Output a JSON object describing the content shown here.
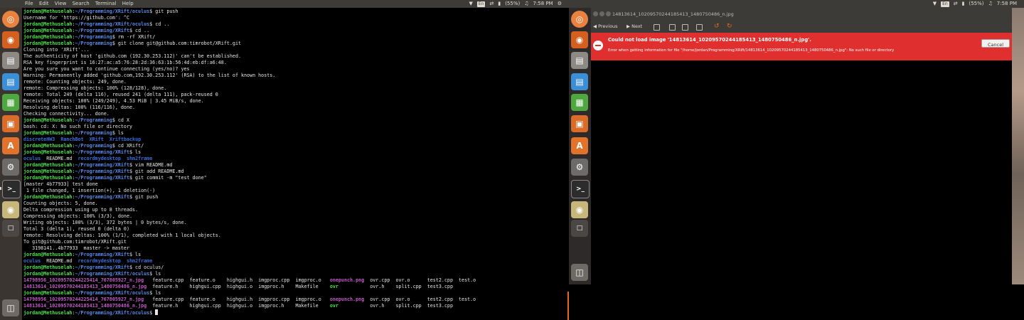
{
  "top_panel": {
    "menus": [
      "File",
      "Edit",
      "View",
      "Search",
      "Terminal",
      "Help"
    ],
    "keyboard": "En",
    "battery": "(55%)",
    "time": "7:58 PM"
  },
  "terminal": {
    "lines": [
      [
        [
          "u",
          "jordan@Methuselah"
        ],
        [
          "plain",
          ":"
        ],
        [
          "p",
          "~/Programming/XRift/oculus"
        ],
        [
          "plain",
          "$ git push"
        ]
      ],
      [
        [
          "plain",
          "Username for 'https://github.com': ^C"
        ]
      ],
      [
        [
          "u",
          "jordan@Methuselah"
        ],
        [
          "plain",
          ":"
        ],
        [
          "p",
          "~/Programming/XRift/oculus"
        ],
        [
          "plain",
          "$ cd .."
        ]
      ],
      [
        [
          "u",
          "jordan@Methuselah"
        ],
        [
          "plain",
          ":"
        ],
        [
          "p",
          "~/Programming/XRift"
        ],
        [
          "plain",
          "$ cd .."
        ]
      ],
      [
        [
          "u",
          "jordan@Methuselah"
        ],
        [
          "plain",
          ":"
        ],
        [
          "p",
          "~/Programming"
        ],
        [
          "plain",
          "$ rm -rf XRift/"
        ]
      ],
      [
        [
          "u",
          "jordan@Methuselah"
        ],
        [
          "plain",
          ":"
        ],
        [
          "p",
          "~/Programming"
        ],
        [
          "plain",
          "$ git clone git@github.com:timrobot/XRift.git"
        ]
      ],
      [
        [
          "plain",
          "Cloning into 'XRift'..."
        ]
      ],
      [
        [
          "plain",
          "The authenticity of host 'github.com (192.30.253.112)' can't be established."
        ]
      ],
      [
        [
          "plain",
          "RSA key fingerprint is 16:27:ac:a5:76:28:2d:36:63:1b:56:4d:eb:df:a6:48."
        ]
      ],
      [
        [
          "plain",
          "Are you sure you want to continue connecting (yes/no)? yes"
        ]
      ],
      [
        [
          "plain",
          "Warning: Permanently added 'github.com,192.30.253.112' (RSA) to the list of known hosts."
        ]
      ],
      [
        [
          "plain",
          "remote: Counting objects: 249, done."
        ]
      ],
      [
        [
          "plain",
          "remote: Compressing objects: 100% (128/128), done."
        ]
      ],
      [
        [
          "plain",
          "remote: Total 249 (delta 116), reused 241 (delta 111), pack-reused 0"
        ]
      ],
      [
        [
          "plain",
          "Receiving objects: 100% (249/249), 4.53 MiB | 3.45 MiB/s, done."
        ]
      ],
      [
        [
          "plain",
          "Resolving deltas: 100% (116/116), done."
        ]
      ],
      [
        [
          "plain",
          "Checking connectivity... done."
        ]
      ],
      [
        [
          "u",
          "jordan@Methuselah"
        ],
        [
          "plain",
          ":"
        ],
        [
          "p",
          "~/Programming"
        ],
        [
          "plain",
          "$ cd X"
        ]
      ],
      [
        [
          "plain",
          "bash: cd: X: No such file or directory"
        ]
      ],
      [
        [
          "u",
          "jordan@Methuselah"
        ],
        [
          "plain",
          ":"
        ],
        [
          "p",
          "~/Programming"
        ],
        [
          "plain",
          "$ ls"
        ]
      ],
      [
        [
          "dir",
          "discreteHW3"
        ],
        [
          "plain",
          "  "
        ],
        [
          "dir",
          "RanchBot"
        ],
        [
          "plain",
          "  "
        ],
        [
          "dir",
          "XRift"
        ],
        [
          "plain",
          "  "
        ],
        [
          "dir",
          "Xriftbackup"
        ]
      ],
      [
        [
          "u",
          "jordan@Methuselah"
        ],
        [
          "plain",
          ":"
        ],
        [
          "p",
          "~/Programming"
        ],
        [
          "plain",
          "$ cd XRift/"
        ]
      ],
      [
        [
          "u",
          "jordan@Methuselah"
        ],
        [
          "plain",
          ":"
        ],
        [
          "p",
          "~/Programming/XRift"
        ],
        [
          "plain",
          "$ ls"
        ]
      ],
      [
        [
          "dir",
          "oculus"
        ],
        [
          "plain",
          "  README.md  "
        ],
        [
          "dir",
          "recordmydesktop"
        ],
        [
          "plain",
          "  "
        ],
        [
          "dir",
          "shm2frame"
        ]
      ],
      [
        [
          "u",
          "jordan@Methuselah"
        ],
        [
          "plain",
          ":"
        ],
        [
          "p",
          "~/Programming/XRift"
        ],
        [
          "plain",
          "$ vim README.md"
        ]
      ],
      [
        [
          "u",
          "jordan@Methuselah"
        ],
        [
          "plain",
          ":"
        ],
        [
          "p",
          "~/Programming/XRift"
        ],
        [
          "plain",
          "$ git add README.md"
        ]
      ],
      [
        [
          "u",
          "jordan@Methuselah"
        ],
        [
          "plain",
          ":"
        ],
        [
          "p",
          "~/Programming/XRift"
        ],
        [
          "plain",
          "$ git commit -m \"test done\""
        ]
      ],
      [
        [
          "plain",
          "[master 4b77933] test done"
        ]
      ],
      [
        [
          "plain",
          " 1 file changed, 1 insertion(+), 1 deletion(-)"
        ]
      ],
      [
        [
          "u",
          "jordan@Methuselah"
        ],
        [
          "plain",
          ":"
        ],
        [
          "p",
          "~/Programming/XRift"
        ],
        [
          "plain",
          "$ git push"
        ]
      ],
      [
        [
          "plain",
          "Counting objects: 5, done."
        ]
      ],
      [
        [
          "plain",
          "Delta compression using up to 8 threads."
        ]
      ],
      [
        [
          "plain",
          "Compressing objects: 100% (3/3), done."
        ]
      ],
      [
        [
          "plain",
          "Writing objects: 100% (3/3), 372 bytes | 0 bytes/s, done."
        ]
      ],
      [
        [
          "plain",
          "Total 3 (delta 1), reused 0 (delta 0)"
        ]
      ],
      [
        [
          "plain",
          "remote: Resolving deltas: 100% (1/1), completed with 1 local objects."
        ]
      ],
      [
        [
          "plain",
          "To git@github.com:timrobot/XRift.git"
        ]
      ],
      [
        [
          "plain",
          "   3198141..4b77933  master -> master"
        ]
      ],
      [
        [
          "u",
          "jordan@Methuselah"
        ],
        [
          "plain",
          ":"
        ],
        [
          "p",
          "~/Programming/XRift"
        ],
        [
          "plain",
          "$ ls"
        ]
      ],
      [
        [
          "dir",
          "oculus"
        ],
        [
          "plain",
          "  README.md  "
        ],
        [
          "dir",
          "recordmydesktop"
        ],
        [
          "plain",
          "  "
        ],
        [
          "dir",
          "shm2frame"
        ]
      ],
      [
        [
          "u",
          "jordan@Methuselah"
        ],
        [
          "plain",
          ":"
        ],
        [
          "p",
          "~/Programming/XRift"
        ],
        [
          "plain",
          "$ cd oculus/"
        ]
      ],
      [
        [
          "u",
          "jordan@Methuselah"
        ],
        [
          "plain",
          ":"
        ],
        [
          "p",
          "~/Programming/XRift/oculus"
        ],
        [
          "plain",
          "$ ls"
        ]
      ],
      [
        [
          "img",
          "14798956_10209570244225414_767805927_n.jpg"
        ],
        [
          "plain",
          "   feature.cpp  feature.o    highgui.h  imgproc.cpp  imgproc.o   "
        ],
        [
          "img",
          "onepunch.png"
        ],
        [
          "plain",
          "  ovr.cpp  ovr.o      test2.cpp  test.o"
        ]
      ],
      [
        [
          "img",
          "14813614_10209570244185413_1480750486_n.jpg"
        ],
        [
          "plain",
          "  feature.h    highgui.cpp  highgui.o  imgproc.h    Makefile    "
        ],
        [
          "ex",
          "ovr"
        ],
        [
          "plain",
          "           ovr.h    split.cpp  test3.cpp"
        ]
      ],
      [
        [
          "u",
          "jordan@Methuselah"
        ],
        [
          "plain",
          ":"
        ],
        [
          "p",
          "~/Programming/XRift/oculus"
        ],
        [
          "plain",
          "$ ls"
        ]
      ],
      [
        [
          "img",
          "14798956_10209570244225414_767805927_n.jpg"
        ],
        [
          "plain",
          "   feature.cpp  feature.o    highgui.h  imgproc.cpp  imgproc.o   "
        ],
        [
          "img",
          "onepunch.png"
        ],
        [
          "plain",
          "  ovr.cpp  ovr.o      test2.cpp  test.o"
        ]
      ],
      [
        [
          "img",
          "14813614_10209570244185413_1480750486_n.jpg"
        ],
        [
          "plain",
          "  feature.h    highgui.cpp  highgui.o  imgproc.h    Makefile    "
        ],
        [
          "ex",
          "ovr"
        ],
        [
          "plain",
          "           ovr.h    split.cpp  test3.cpp"
        ]
      ],
      [
        [
          "u",
          "jordan@Methuselah"
        ],
        [
          "plain",
          ":"
        ],
        [
          "p",
          "~/Programming/XRift/oculus"
        ],
        [
          "plain",
          "$ "
        ],
        [
          "cursor",
          ""
        ]
      ]
    ]
  },
  "viewer": {
    "title": "14813614_10209570244185413_1480750486_n.jpg",
    "toolbar": {
      "previous": "Previous",
      "next": "Next"
    },
    "error": {
      "title": "Could not load image '14813614_10209570244185413_1480750486_n.jpg'.",
      "detail": "Error when getting information for file \"/home/jordan/Programming/XRift/14813614_10209570244185413_1480750486_n.jpg\": No such file or directory",
      "cancel": "Cancel"
    }
  },
  "launcher_icons": [
    "ubuntu-dash-icon",
    "firefox-icon",
    "files-icon",
    "writer-icon",
    "calc-icon",
    "impress-icon",
    "software-center-icon",
    "settings-icon",
    "terminal-icon",
    "image-viewer-icon",
    "workspace-icon",
    "trash-icon"
  ]
}
